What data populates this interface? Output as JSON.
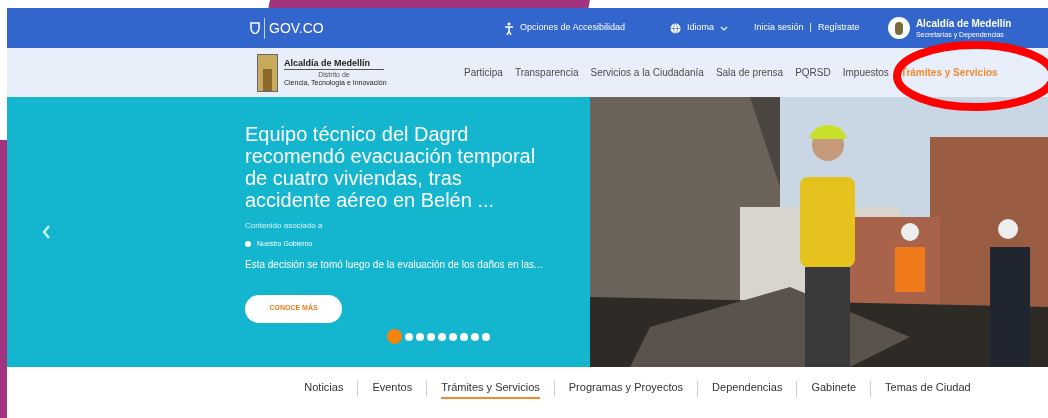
{
  "top_bar": {
    "brand": "GOV.CO",
    "accessibility": "Opciones de Accesibilidad",
    "language": "Idioma",
    "login": "Inicia sesión",
    "separator": "|",
    "register": "Regístrate",
    "account": {
      "title": "Alcaldía de Medellín",
      "subtitle": "Secretarías y Dependencias"
    }
  },
  "header": {
    "logo": {
      "title": "Alcaldía de Medellín",
      "district": "Distrito de",
      "tagline": "Ciencia, Tecnología e Innovación"
    },
    "nav": [
      {
        "label": "Participa",
        "selected": false
      },
      {
        "label": "Transparencia",
        "selected": false
      },
      {
        "label": "Servicios a la Ciudadanía",
        "selected": false
      },
      {
        "label": "Sala de prensa",
        "selected": false
      },
      {
        "label": "PQRSD",
        "selected": false
      },
      {
        "label": "Impuestos",
        "selected": false
      },
      {
        "label": "Trámites y Servicios",
        "selected": true
      }
    ]
  },
  "hero": {
    "title": "Equipo técnico del Dagrd recomendó evacuación temporal de cuatro viviendas, tras accidente aéreo en Belén ...",
    "associated_label": "Contenido asociado a",
    "tag": "Nuestro Gobierno",
    "summary": "Esta decisión se tomó luego de la evaluación de los daños en las...",
    "button": "CONOCE MÁS",
    "dots": [
      {
        "selected": true
      },
      {
        "selected": false
      },
      {
        "selected": false
      },
      {
        "selected": false
      },
      {
        "selected": false
      },
      {
        "selected": false
      },
      {
        "selected": false
      },
      {
        "selected": false
      },
      {
        "selected": false
      }
    ]
  },
  "bottom_nav": [
    {
      "label": "Noticias",
      "selected": false
    },
    {
      "label": "Eventos",
      "selected": false
    },
    {
      "label": "Trámites y Servicios",
      "selected": true
    },
    {
      "label": "Programas y Proyectos",
      "selected": false
    },
    {
      "label": "Dependencias",
      "selected": false
    },
    {
      "label": "Gabinete",
      "selected": false
    },
    {
      "label": "Temas de Ciudad",
      "selected": false
    }
  ],
  "annotation": {
    "kind": "ellipse"
  }
}
